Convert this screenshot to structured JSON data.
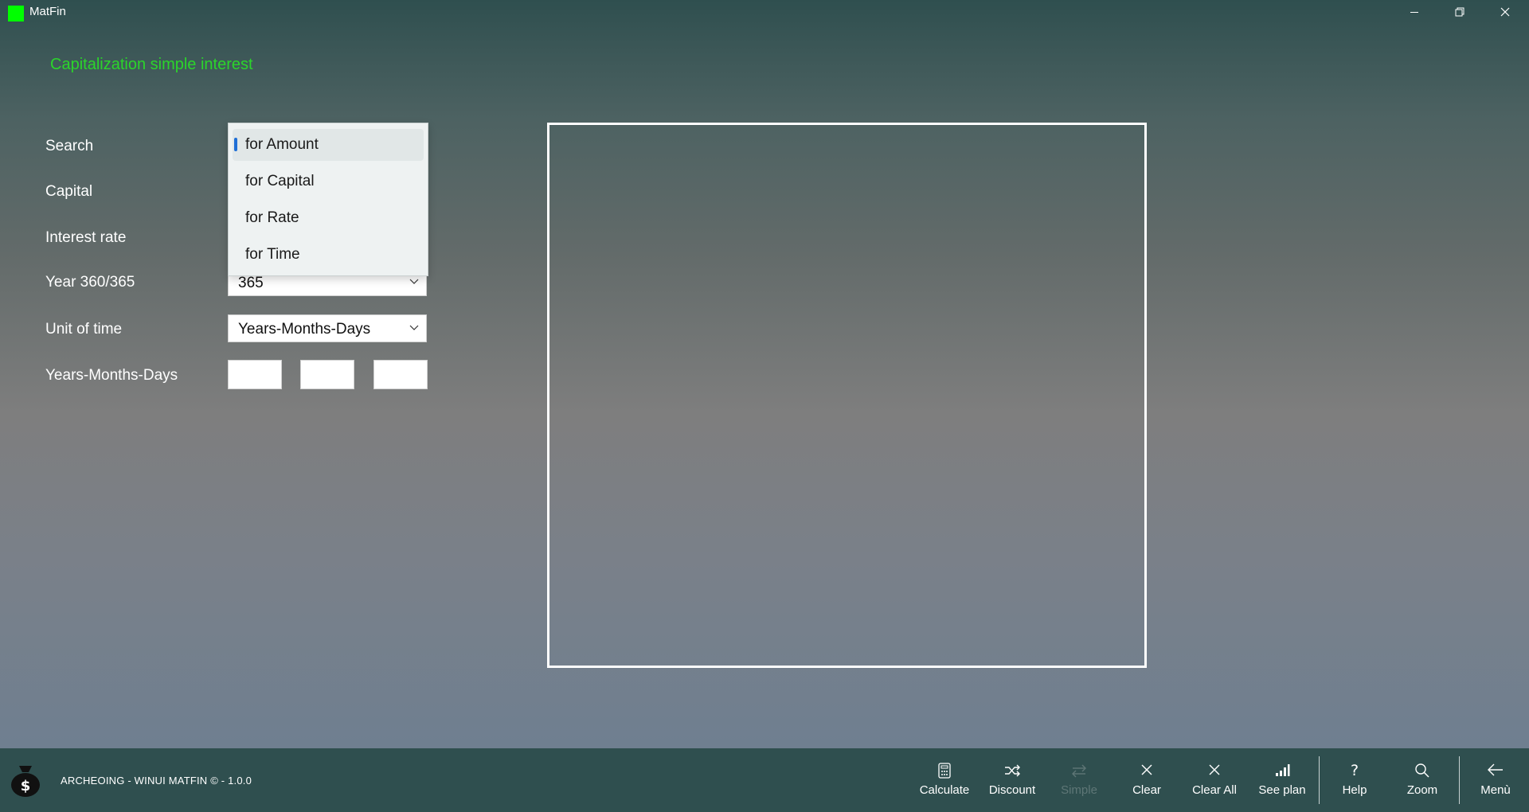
{
  "window": {
    "title": "MatFin"
  },
  "page": {
    "heading": "Capitalization simple interest"
  },
  "form": {
    "labels": {
      "search": "Search",
      "capital": "Capital",
      "interest_rate": "Interest rate",
      "year_basis": "Year 360/365",
      "unit_of_time": "Unit of time",
      "years_months_days": "Years-Months-Days"
    },
    "year_basis_value": "365",
    "unit_of_time_value": "Years-Months-Days",
    "search_dropdown": {
      "selected": "for Amount",
      "options": [
        "for Amount",
        "for Capital",
        "for Rate",
        "for Time"
      ]
    }
  },
  "footer": {
    "text": "ARCHEOING - WINUI MATFIN © - 1.0.0"
  },
  "toolbar": {
    "calculate": "Calculate",
    "discount": "Discount",
    "simple": "Simple",
    "clear": "Clear",
    "clear_all": "Clear All",
    "see_plan": "See plan",
    "help": "Help",
    "zoom": "Zoom",
    "menu": "Menù"
  },
  "colors": {
    "accent_green": "#2bd52b",
    "logo_green": "#00ff00",
    "bar_background": "#2f4f4f",
    "selection_indicator": "#1f6fd6"
  }
}
